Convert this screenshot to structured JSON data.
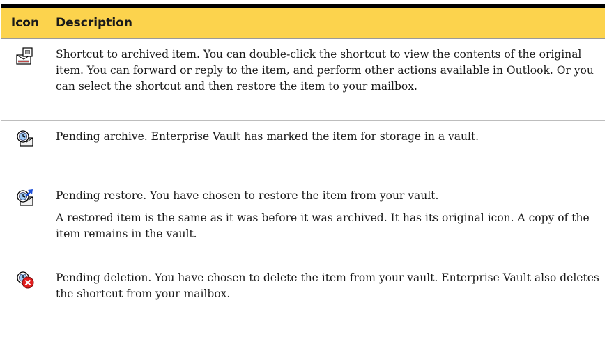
{
  "header": {
    "icon_col": "Icon",
    "description_col": "Description"
  },
  "rows": [
    {
      "icon": "archived-shortcut-icon",
      "paragraphs": [
        "Shortcut to archived item. You can double-click the shortcut to view the contents of the original item. You can forward or reply to the item, and perform other actions available in Outlook. Or you can select the shortcut and then restore the item to your mailbox."
      ]
    },
    {
      "icon": "pending-archive-icon",
      "paragraphs": [
        "Pending archive. Enterprise Vault has marked the item for storage in a vault."
      ]
    },
    {
      "icon": "pending-restore-icon",
      "paragraphs": [
        "Pending restore. You have chosen to restore the item from your vault.",
        "A restored item is the same as it was before it was archived. It has its original icon. A copy of the item remains in the vault."
      ]
    },
    {
      "icon": "pending-deletion-icon",
      "paragraphs": [
        "Pending deletion. You have chosen to delete the item from your vault. Enterprise Vault also deletes the shortcut from your mailbox."
      ]
    }
  ],
  "colors": {
    "header_bg": "#fcd34d",
    "top_rule": "#000000",
    "delete_badge": "#e11d1d"
  }
}
